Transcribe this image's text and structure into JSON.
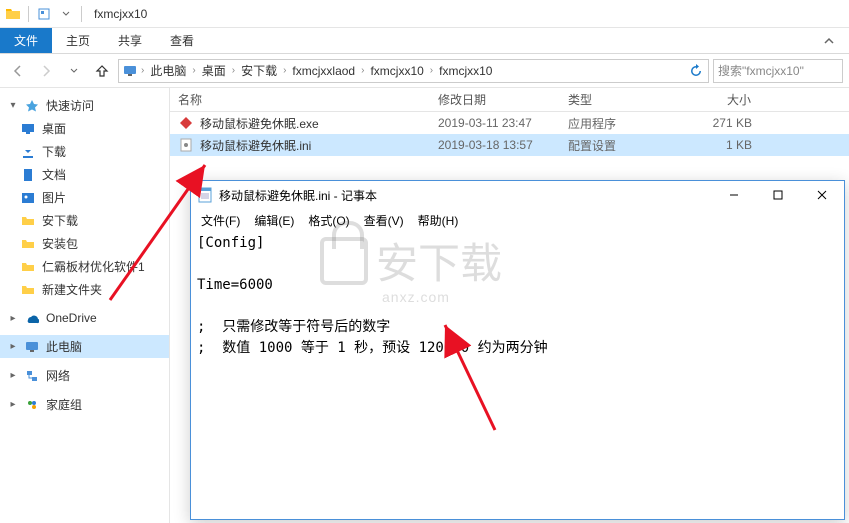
{
  "window": {
    "title": "fxmcjxx10"
  },
  "ribbon": {
    "file": "文件",
    "tabs": [
      "主页",
      "共享",
      "查看"
    ]
  },
  "breadcrumb": {
    "items": [
      "此电脑",
      "桌面",
      "安下载",
      "fxmcjxxlaod",
      "fxmcjxx10",
      "fxmcjxx10"
    ]
  },
  "search": {
    "placeholder": "搜索\"fxmcjxx10\""
  },
  "sidebar": {
    "quick": {
      "label": "快速访问",
      "items": [
        "桌面",
        "下载",
        "文档",
        "图片",
        "安下载",
        "安装包",
        "仁霸板材优化软件1",
        "新建文件夹"
      ]
    },
    "onedrive": "OneDrive",
    "thispc": "此电脑",
    "network": "网络",
    "homegroup": "家庭组"
  },
  "columns": {
    "name": "名称",
    "date": "修改日期",
    "type": "类型",
    "size": "大小"
  },
  "files": [
    {
      "name": "移动鼠标避免休眠.exe",
      "date": "2019-03-11 23:47",
      "type": "应用程序",
      "size": "271 KB"
    },
    {
      "name": "移动鼠标避免休眠.ini",
      "date": "2019-03-18 13:57",
      "type": "配置设置",
      "size": "1 KB"
    }
  ],
  "notepad": {
    "title": "移动鼠标避免休眠.ini - 记事本",
    "menu": {
      "file": "文件(F)",
      "edit": "编辑(E)",
      "format": "格式(O)",
      "view": "查看(V)",
      "help": "帮助(H)"
    },
    "content": "[Config]\n\nTime=6000\n\n;  只需修改等于符号后的数字\n;  数值 1000 等于 1 秒，预设 120000 约为两分钟"
  },
  "watermark": {
    "text": "安下载",
    "sub": "anxz.com"
  }
}
